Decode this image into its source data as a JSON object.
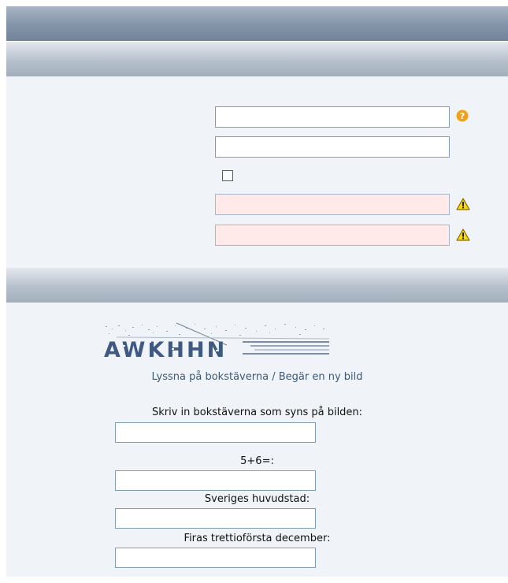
{
  "form": {
    "fields": [
      {
        "value": "",
        "state": "normal",
        "has_help": true
      },
      {
        "value": "",
        "state": "normal",
        "has_help": false
      },
      {
        "value": "",
        "state": "error"
      },
      {
        "value": "",
        "state": "error"
      }
    ],
    "checkbox_checked": false
  },
  "captcha": {
    "image_text": "AWKHHN",
    "listen_link": "Lyssna på bokstäverna",
    "separator": " / ",
    "new_image_link": "Begär en ny bild",
    "letters_label": "Skriv in bokstäverna som syns på bilden:",
    "letters_value": "",
    "math_label": "5+6=:",
    "math_value": "",
    "capital_label": "Sveriges huvudstad:",
    "capital_value": "",
    "holiday_label": "Firas trettioförsta december:",
    "holiday_value": ""
  },
  "colors": {
    "panel": "#f0f3f7",
    "error_field": "#ffe9e9",
    "help_icon": "#f2a21a",
    "warning_icon": "#f5d90a",
    "link": "#3a5a7a"
  },
  "icons": {
    "help": "question-circle",
    "warning": "warning-triangle"
  }
}
